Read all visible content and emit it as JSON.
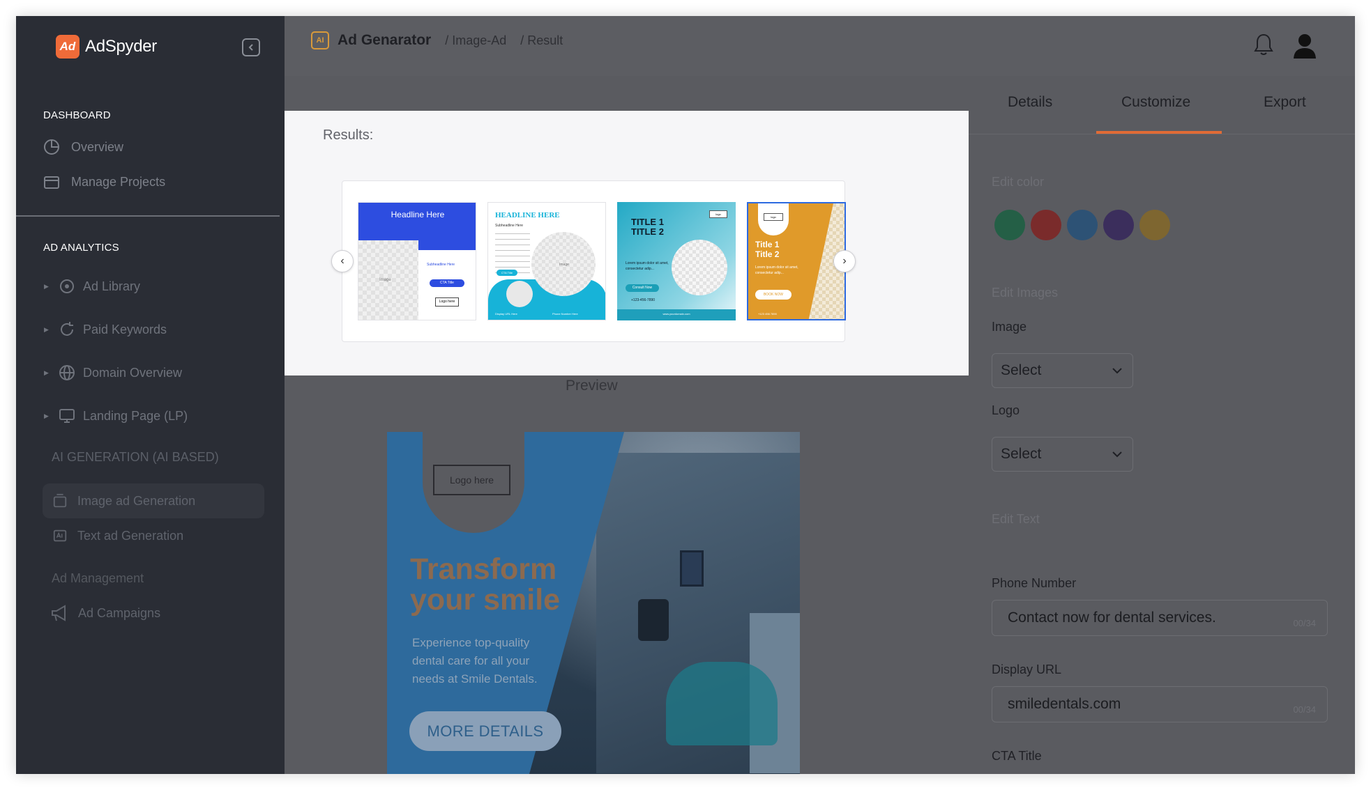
{
  "app": {
    "name": "AdSpyder",
    "logo_mark": "Ad"
  },
  "sidebar": {
    "dashboard_label": "DASHBOARD",
    "dashboard_items": [
      {
        "label": "Overview",
        "icon": "pie-chart-icon"
      },
      {
        "label": "Manage Projects",
        "icon": "folder-icon"
      }
    ],
    "analytics_label": "AD ANALYTICS",
    "analytics_items": [
      {
        "label": "Ad Library",
        "icon": "library-icon"
      },
      {
        "label": "Paid Keywords",
        "icon": "refresh-icon"
      },
      {
        "label": "Domain Overview",
        "icon": "globe-icon"
      },
      {
        "label": "Landing Page (LP)",
        "icon": "monitor-icon"
      }
    ],
    "ai_label": "AI GENERATION (AI BASED)",
    "image_gen": "Image ad Generation",
    "text_gen": "Text ad Generation",
    "ad_management": "Ad Management",
    "ad_campaigns": "Ad Campaigns"
  },
  "topbar": {
    "ai_chip": "AI",
    "title": "Ad Genarator",
    "crumbs": [
      "/ Image-Ad",
      "/ Result"
    ]
  },
  "results": {
    "title": "Results:",
    "thumbs": [
      {
        "headline": "Headline Here",
        "sub": "Subheadline Here",
        "cta": "CTA Title",
        "logo": "Logo here",
        "image": "Image"
      },
      {
        "headline": "HEADLINE HERE",
        "sub": "Subheadline Here",
        "cta": "CTA Title",
        "image": "Image",
        "footer_left": "Display URL Here",
        "footer_right": "Phone Number Here"
      },
      {
        "headline": "TITLE 1\nTITLE 2",
        "body": "Lorem ipsum dolor sit amet, consectetur adip...",
        "cta": "Consult Now",
        "phone": "+123-456-7890",
        "logo": "logo",
        "footer": "www.yourdomain.com"
      },
      {
        "headline": "Title 1\nTitle 2",
        "body": "Lorem ipsum dolor sit amet, consectetur adip...",
        "cta": "BOOK NOW",
        "logo": "logo",
        "phone": "+123 456 7890"
      }
    ]
  },
  "preview": {
    "label": "Preview",
    "logo": "Logo here",
    "headline": "Transform your smile",
    "sub": "Experience top-quality dental care for all your needs at Smile Dentals.",
    "cta": "MORE DETAILS"
  },
  "panel": {
    "tabs": [
      "Details",
      "Customize",
      "Export"
    ],
    "edit_color": "Edit color",
    "colors": [
      "#245f46",
      "#7a2b2b",
      "#2d5275",
      "#3b2e5c",
      "#7e6630"
    ],
    "edit_images": "Edit Images",
    "image_label": "Image",
    "image_value": "Select",
    "logo_label": "Logo",
    "logo_value": "Select",
    "edit_text": "Edit Text",
    "phone_label": "Phone Number",
    "phone_value": "Contact now for dental services.",
    "phone_counter": "00/34",
    "url_label": "Display URL",
    "url_value": "smiledentals.com",
    "url_counter": "00/34",
    "cta_label": "CTA Title"
  }
}
